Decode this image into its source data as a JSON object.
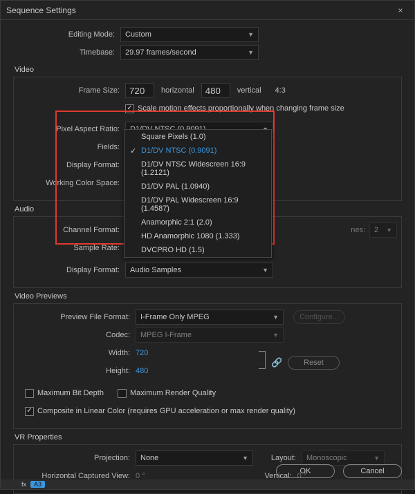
{
  "title": "Sequence Settings",
  "labels": {
    "editing_mode": "Editing Mode:",
    "timebase": "Timebase:",
    "video": "Video",
    "frame_size": "Frame Size:",
    "horizontal": "horizontal",
    "vertical": "vertical",
    "aspect": "4:3",
    "scale_motion": "Scale motion effects proportionally when changing frame size",
    "par": "Pixel Aspect Ratio:",
    "fields": "Fields:",
    "display_format_v": "Display Format:",
    "working_color": "Working Color Space:",
    "audio": "Audio",
    "channel_format": "Channel Format:",
    "sample_rate": "Sample Rate:",
    "display_format_a": "Display Format:",
    "previews": "Video Previews",
    "preview_format": "Preview File Format:",
    "codec": "Codec:",
    "width": "Width:",
    "height": "Height:",
    "max_bit": "Maximum Bit Depth",
    "max_render": "Maximum Render Quality",
    "composite": "Composite in Linear Color (requires GPU acceleration or max render quality)",
    "vr": "VR Properties",
    "projection": "Projection:",
    "layout": "Layout:",
    "hcv": "Horizontal Captured View:",
    "vcv": "Vertical:",
    "configure": "Configure...",
    "reset": "Reset",
    "ok": "OK",
    "cancel": "Cancel",
    "nes": "nes:",
    "nes_val": "2"
  },
  "values": {
    "editing_mode": "Custom",
    "timebase": "29.97  frames/second",
    "frame_w": "720",
    "frame_h": "480",
    "par": "D1/DV NTSC (0.9091)",
    "display_format_a": "Audio Samples",
    "preview_format": "I-Frame Only MPEG",
    "codec": "MPEG I-Frame",
    "width": "720",
    "height": "480",
    "projection": "None",
    "layout": "Monoscopic",
    "hcv": "0 °",
    "vcv": "0 °",
    "tag": "A3"
  },
  "dropdown": [
    "Square Pixels (1.0)",
    "D1/DV NTSC (0.9091)",
    "D1/DV NTSC Widescreen 16:9 (1.2121)",
    "D1/DV PAL (1.0940)",
    "D1/DV PAL Widescreen 16:9 (1.4587)",
    "Anamorphic 2:1 (2.0)",
    "HD Anamorphic 1080 (1.333)",
    "DVCPRO HD (1.5)"
  ],
  "checks": {
    "scale_motion": true,
    "max_bit": false,
    "max_render": false,
    "composite": true
  }
}
